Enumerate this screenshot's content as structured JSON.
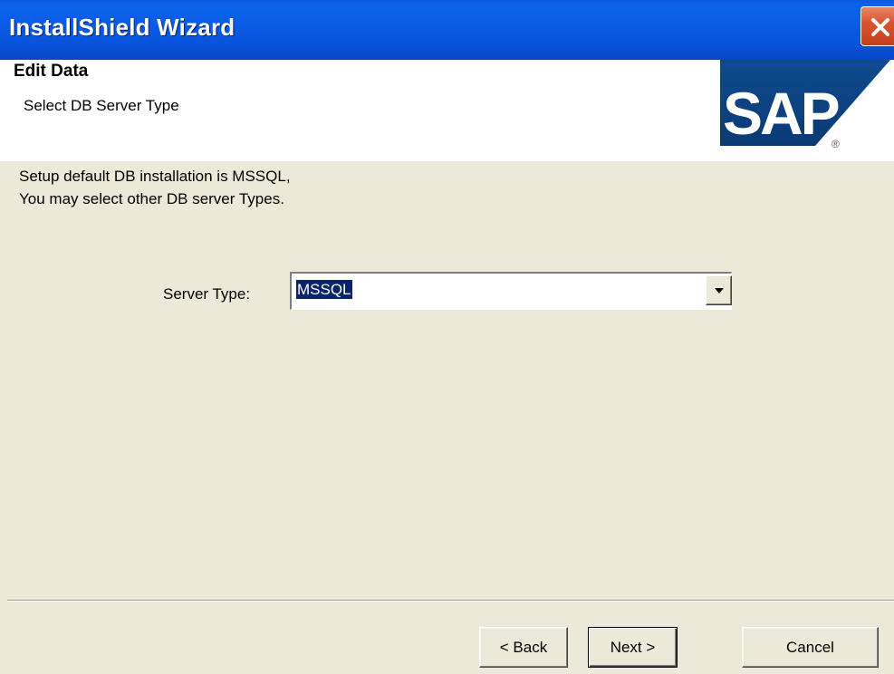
{
  "window": {
    "title": "InstallShield Wizard",
    "close_icon": "close-icon",
    "close_color": "#D9542E",
    "titlebar_color": "#0A5AE4"
  },
  "header": {
    "title": "Edit Data",
    "subtitle": "Select DB Server Type",
    "band_color": "#3C6A9E",
    "logo": "SAP"
  },
  "content": {
    "description_lines": [
      "Setup default DB installation is MSSQL,",
      "You may select other  DB server Types."
    ],
    "server_type_label": "Server Type:",
    "server_type_value": "MSSQL",
    "dropdown_icon": "chevron-down-icon"
  },
  "buttons": {
    "back": "< Back",
    "next": "Next >",
    "cancel": "Cancel"
  }
}
